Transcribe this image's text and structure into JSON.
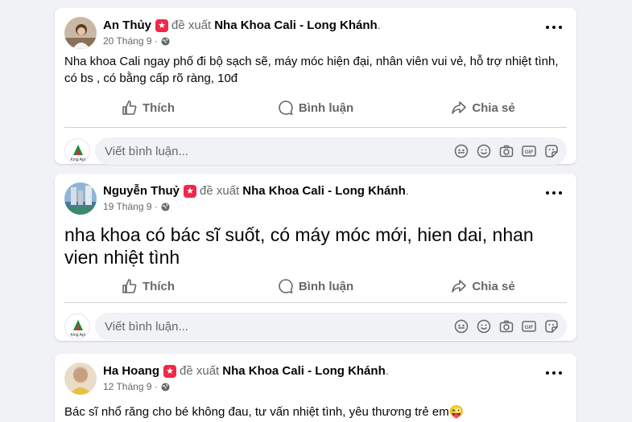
{
  "posts": [
    {
      "author": "An Thủy",
      "recommends": "đề xuất",
      "page": "Nha Khoa Cali - Long Khánh",
      "date": "20 Tháng 9",
      "sep": "·",
      "text": "Nha khoa Cali ngay phố đi bộ sạch sẽ, máy móc hiện đại, nhân viên vui vẻ, hỗ trợ nhiệt tình, có bs , có bằng cấp rõ ràng,  10đ"
    },
    {
      "author": "Nguyễn Thuỷ",
      "recommends": "đề xuất",
      "page": "Nha Khoa Cali - Long Khánh",
      "date": "19 Tháng 9",
      "sep": "·",
      "text": "nha khoa có bác sĩ suốt, có máy móc mới, hien dai, nhan vien nhiệt tình"
    },
    {
      "author": "Ha Hoang",
      "recommends": "đề xuất",
      "page": "Nha Khoa Cali - Long Khánh",
      "date": "12 Tháng 9",
      "sep": "·",
      "text": "Bác sĩ nhổ răng cho bé không đau, tư vấn nhiệt tình, yêu thương trẻ em😜"
    }
  ],
  "actions": {
    "like": "Thích",
    "comment": "Bình luận",
    "share": "Chia sẻ"
  },
  "comment_box": {
    "placeholder": "Viết bình luận...",
    "avatar_label": "King Apr"
  },
  "colors": {
    "background": "#f0f2f5",
    "secondary_text": "#65676b",
    "badge": "#f02849"
  }
}
